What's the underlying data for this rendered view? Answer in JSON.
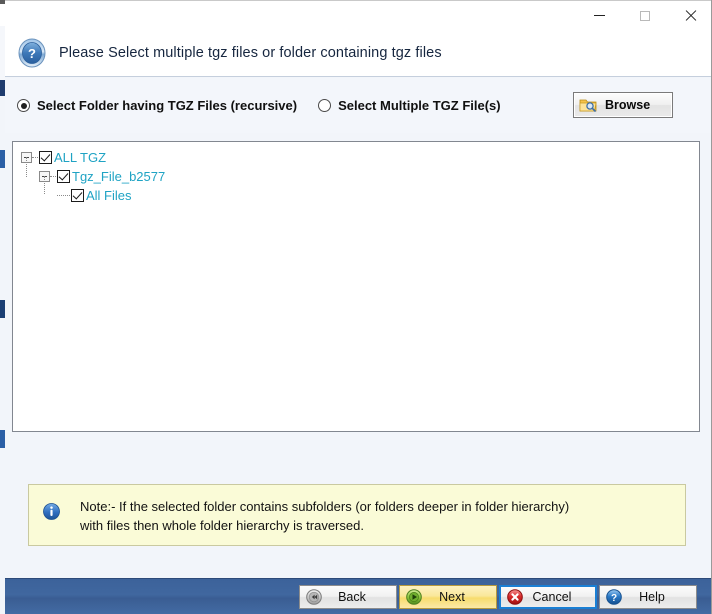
{
  "window": {
    "minimize_label": "Minimize",
    "maximize_label": "Maximize",
    "close_label": "Close"
  },
  "header": {
    "icon": "question-circle-icon",
    "title": "Please Select multiple tgz files or folder containing tgz files"
  },
  "options": {
    "folder_radio_label": "Select Folder having TGZ Files (recursive)",
    "folder_radio_selected": true,
    "files_radio_label": "Select Multiple TGZ File(s)",
    "files_radio_selected": false,
    "browse_label": "Browse",
    "browse_icon": "folder-search-icon"
  },
  "tree": {
    "nodes": [
      {
        "label": "ALL TGZ",
        "level": 1,
        "checked": true,
        "expanded": true,
        "has_toggle": true
      },
      {
        "label": "Tgz_File_b2577",
        "level": 2,
        "checked": true,
        "expanded": true,
        "has_toggle": true
      },
      {
        "label": "All Files",
        "level": 3,
        "checked": true,
        "expanded": false,
        "has_toggle": false
      }
    ],
    "text_color": "#1fa3c4"
  },
  "note": {
    "icon": "info-circle-icon",
    "text": "Note:- If the selected folder contains subfolders (or folders deeper in folder hierarchy)\n with files then whole folder hierarchy is traversed."
  },
  "footer": {
    "buttons": [
      {
        "label": "Back",
        "icon": "rewind-circle-icon",
        "state": "normal"
      },
      {
        "label": "Next",
        "icon": "play-circle-icon",
        "state": "default"
      },
      {
        "label": "Cancel",
        "icon": "error-circle-icon",
        "state": "focused"
      },
      {
        "label": "Help",
        "icon": "question-circle-icon",
        "state": "normal"
      }
    ]
  },
  "colors": {
    "accent_blue": "#3c629a",
    "tree_teal": "#1fa3c4",
    "note_bg": "#fafbd7",
    "next_yellow": "#f7dc6d",
    "focus_blue": "#1a7fd4"
  }
}
